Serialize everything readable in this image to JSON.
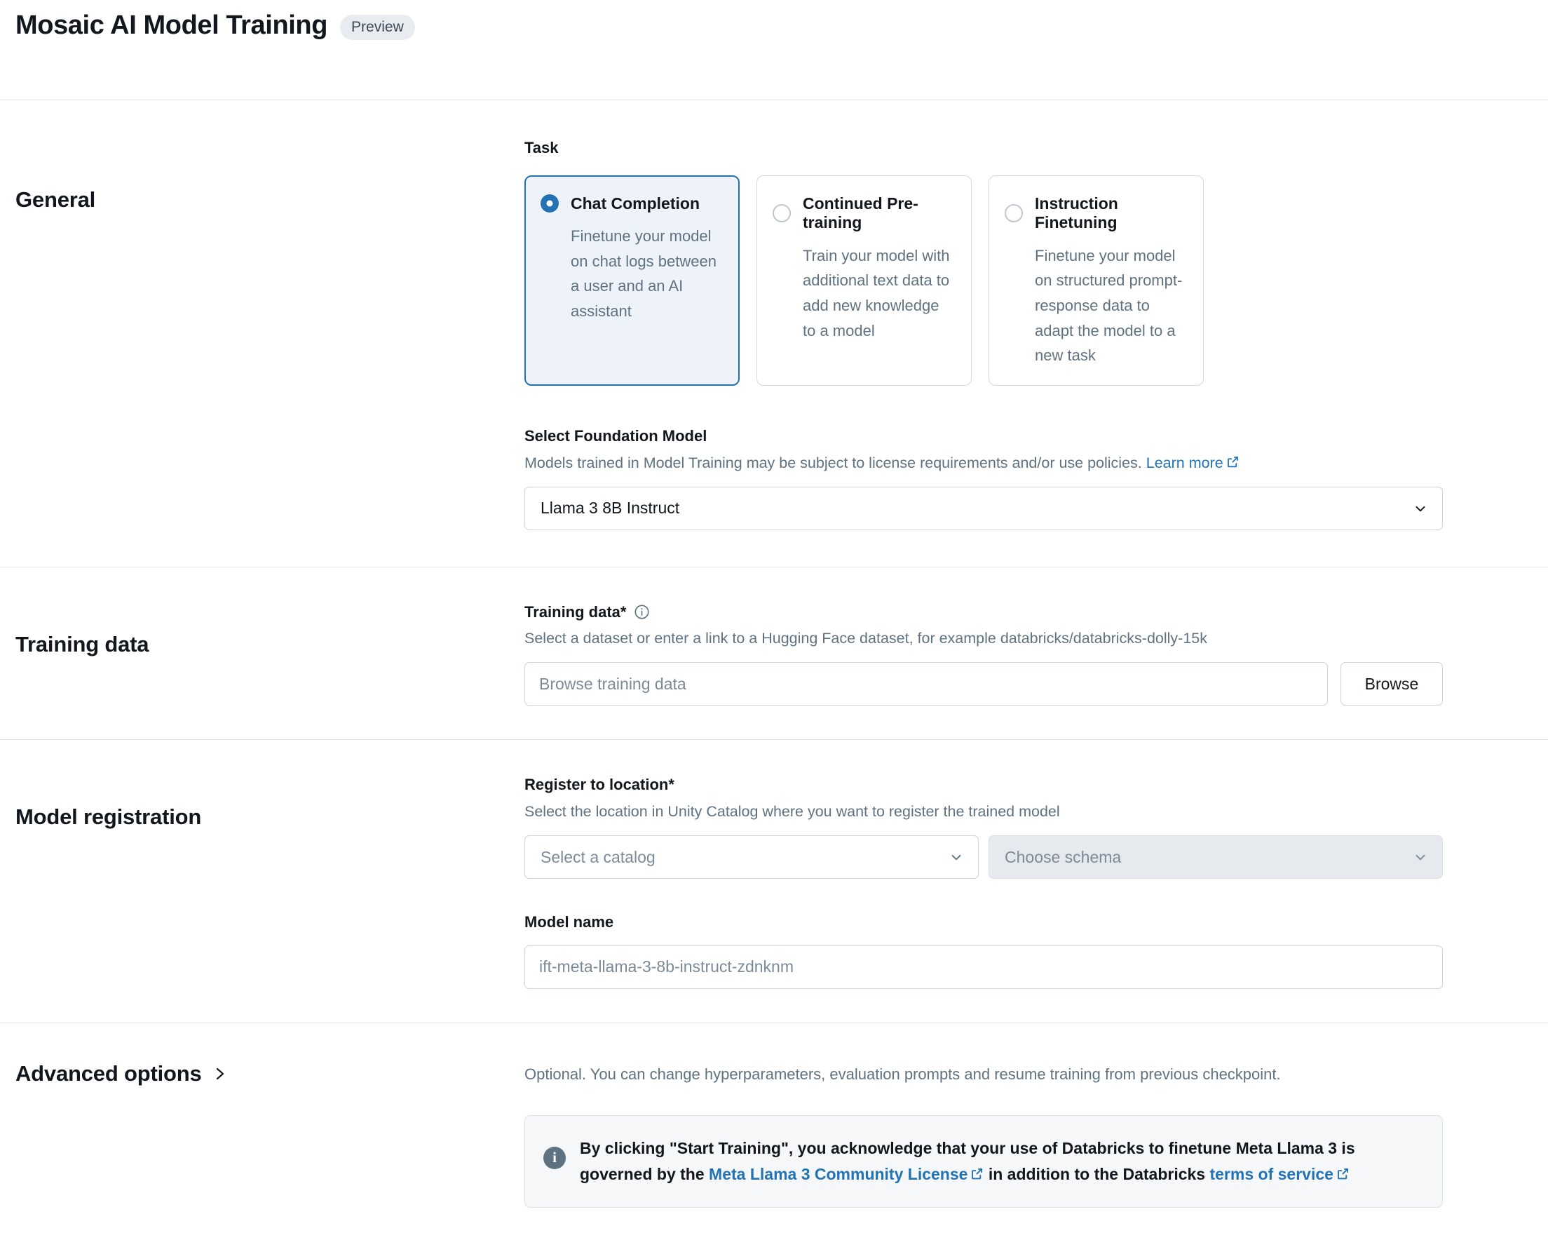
{
  "header": {
    "title": "Mosaic AI Model Training",
    "badge": "Preview"
  },
  "general": {
    "heading": "General",
    "task_label": "Task",
    "tasks": [
      {
        "title": "Chat Completion",
        "description": "Finetune your model on chat logs between a user and an AI assistant",
        "selected": true
      },
      {
        "title": "Continued Pre-training",
        "description": "Train your model with additional text data to add new knowledge to a model",
        "selected": false
      },
      {
        "title": "Instruction Finetuning",
        "description": "Finetune your model on structured prompt-response data to adapt the model to a new task",
        "selected": false
      }
    ],
    "foundation_model": {
      "label": "Select Foundation Model",
      "description": "Models trained in Model Training may be subject to license requirements and/or use policies.",
      "learn_more": "Learn more",
      "selected_value": "Llama 3 8B Instruct"
    }
  },
  "training_data": {
    "heading": "Training data",
    "label": "Training data*",
    "description": "Select a dataset or enter a link to a Hugging Face dataset, for example databricks/databricks-dolly-15k",
    "input_placeholder": "Browse training data",
    "browse_button": "Browse"
  },
  "model_registration": {
    "heading": "Model registration",
    "location_label": "Register to location*",
    "location_description": "Select the location in Unity Catalog where you want to register the trained model",
    "catalog_placeholder": "Select a catalog",
    "schema_placeholder": "Choose schema",
    "model_name_label": "Model name",
    "model_name_placeholder": "ift-meta-llama-3-8b-instruct-zdnknm"
  },
  "advanced": {
    "heading": "Advanced options",
    "description": "Optional. You can change hyperparameters, evaluation prompts and resume training from previous checkpoint."
  },
  "banner": {
    "part1": "By clicking \"Start Training\", you acknowledge that your use of Databricks to finetune Meta Llama 3 is governed by the ",
    "link1": "Meta Llama 3 Community License",
    "part2": " in addition to the Databricks ",
    "link2": "terms of service"
  },
  "colors": {
    "accent": "#2272b4",
    "selected_card_bg": "#eef3f9",
    "muted_text": "#5f7281",
    "banner_bg": "#f5f7f9"
  }
}
